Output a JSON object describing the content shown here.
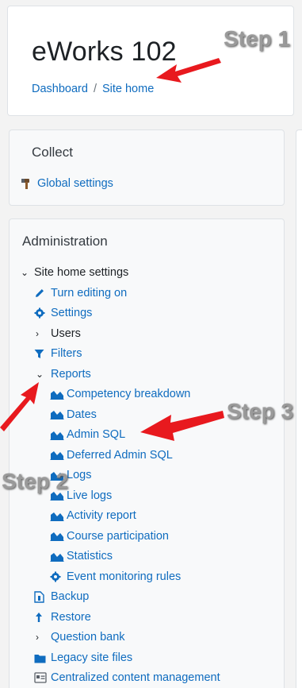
{
  "header": {
    "title": "eWorks 102",
    "breadcrumb": {
      "dashboard": "Dashboard",
      "separator": "/",
      "site_home": "Site home"
    }
  },
  "collect": {
    "title": "Collect",
    "global_settings": "Global settings"
  },
  "admin": {
    "title": "Administration",
    "site_home_settings": "Site home settings",
    "turn_editing_on": "Turn editing on",
    "settings": "Settings",
    "users": "Users",
    "filters": "Filters",
    "reports": "Reports",
    "report_items": [
      "Competency breakdown",
      "Dates",
      "Admin SQL",
      "Deferred Admin SQL",
      "Logs",
      "Live logs",
      "Activity report",
      "Course participation",
      "Statistics",
      "Event monitoring rules"
    ],
    "backup": "Backup",
    "restore": "Restore",
    "question_bank": "Question bank",
    "legacy_site_files": "Legacy site files",
    "centralized_content": "Centralized content management"
  },
  "annotations": {
    "step1": "Step 1",
    "step2": "Step 2",
    "step3": "Step 3"
  },
  "colors": {
    "link": "#0f6cbf",
    "arrow": "#e8191e",
    "step_label": "#9a9a9a"
  }
}
